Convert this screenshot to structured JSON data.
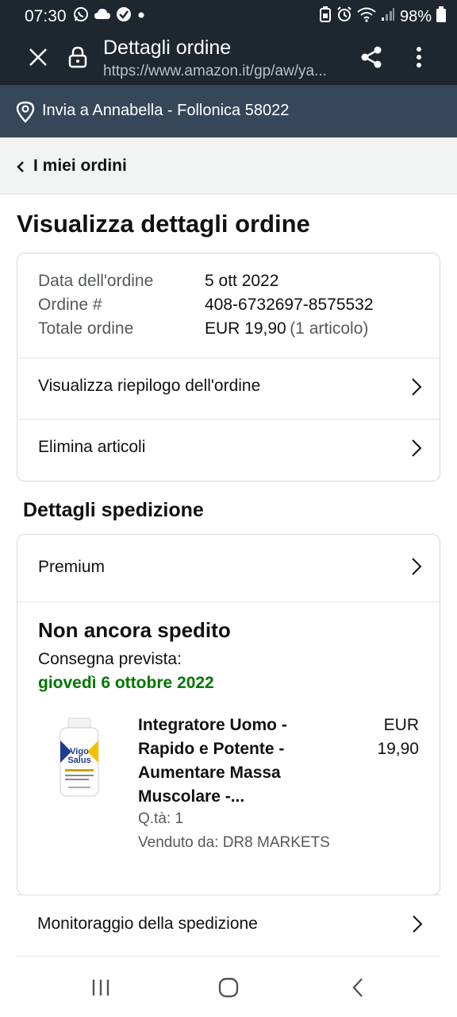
{
  "status_bar": {
    "time": "07:30",
    "battery": "98%"
  },
  "browser": {
    "title": "Dettagli ordine",
    "url": "https://www.amazon.it/gp/aw/ya..."
  },
  "deliver_to": "Invia a Annabella - Follonica 58022",
  "breadcrumb": "I miei ordini",
  "page_title": "Visualizza dettagli ordine",
  "order": {
    "date_label": "Data dell'ordine",
    "date_value": "5 ott 2022",
    "number_label": "Ordine #",
    "number_value": "408-6732697-8575532",
    "total_label": "Totale ordine",
    "total_value": "EUR 19,90",
    "total_items": "(1 articolo)",
    "summary_link": "Visualizza riepilogo dell'ordine",
    "delete_link": "Elimina articoli"
  },
  "shipping": {
    "section_title": "Dettagli spedizione",
    "method": "Premium",
    "status": "Non ancora spedito",
    "delivery_label": "Consegna prevista:",
    "delivery_date": "giovedì 6 ottobre 2022",
    "product": {
      "image_brand": "Vigo Salus",
      "title_line1": "Integratore Uomo -",
      "title_line2": "Rapido e Potente -",
      "title_line3": "Aumentare Massa",
      "title_line4": "Muscolare -...",
      "price_currency": "EUR",
      "price_amount": "19,90",
      "qty": "Q.tà: 1",
      "seller": "Venduto da: DR8 MARKETS"
    },
    "tracking_link": "Monitoraggio della spedizione"
  },
  "colors": {
    "top_bar": "#1e272f",
    "deliver_bar": "#37475a",
    "delivery_green": "#007600"
  }
}
